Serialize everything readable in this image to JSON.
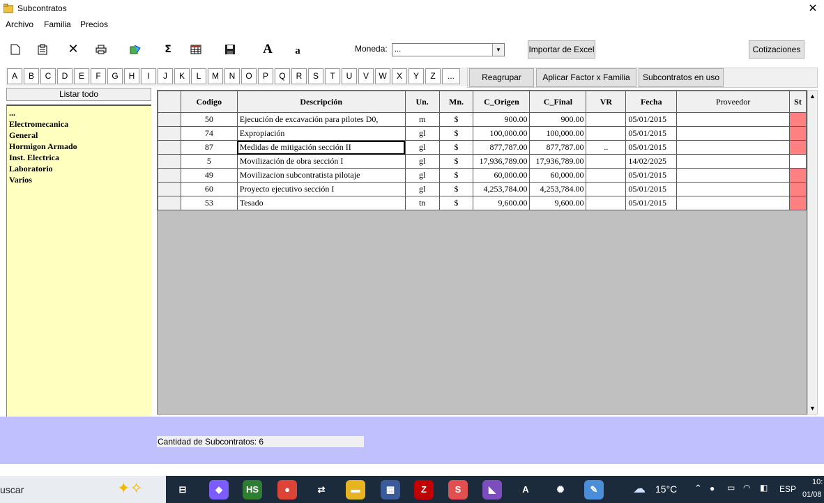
{
  "window": {
    "title": "Subcontratos",
    "close": "✕"
  },
  "menu": [
    {
      "label": "Archivo"
    },
    {
      "label": "Familia"
    },
    {
      "label": "Precios"
    }
  ],
  "toolbar": {
    "icons": [
      "new-document-icon",
      "properties-icon",
      "delete-icon",
      "print-icon",
      "import-icon",
      "sum-icon",
      "table-icon",
      "save-icon",
      "font-large-icon",
      "font-small-icon"
    ],
    "sum_glyph": "Σ",
    "font_large": "A",
    "font_small": "a",
    "moneda_label": "Moneda:",
    "moneda_value": "...",
    "importar_label": "Importar de Excel",
    "cotizaciones_label": "Cotizaciones"
  },
  "letters": [
    "A",
    "B",
    "C",
    "D",
    "E",
    "F",
    "G",
    "H",
    "I",
    "J",
    "K",
    "L",
    "M",
    "N",
    "O",
    "P",
    "Q",
    "R",
    "S",
    "T",
    "U",
    "V",
    "W",
    "X",
    "Y",
    "Z",
    "..."
  ],
  "actions": {
    "reagrupar": "Reagrupar",
    "aplicar": "Aplicar Factor x Familia",
    "en_uso": "Subcontratos en uso"
  },
  "sidebar": {
    "listar_label": "Listar todo",
    "families": [
      "...",
      "Electromecanica",
      "General",
      "Hormigon Armado",
      "Inst. Electrica",
      "Laboratorio",
      "Varios"
    ]
  },
  "grid": {
    "columns": [
      "Codigo",
      "Descripción",
      "Un.",
      "Mn.",
      "C_Origen",
      "C_Final",
      "VR",
      "Fecha",
      "Proveedor",
      "St"
    ],
    "rows": [
      {
        "codigo": "50",
        "desc": "Ejecución de excavación para pilotes D0,",
        "un": "m",
        "mn": "$",
        "origen": "900.00",
        "final": "900.00",
        "vr": "",
        "fecha": "05/01/2015",
        "prov": "",
        "st": "red"
      },
      {
        "codigo": "74",
        "desc": "Expropiación",
        "un": "gl",
        "mn": "$",
        "origen": "100,000.00",
        "final": "100,000.00",
        "vr": "",
        "fecha": "05/01/2015",
        "prov": "",
        "st": "red"
      },
      {
        "codigo": "87",
        "desc": "Medidas de mitigación sección II",
        "un": "gl",
        "mn": "$",
        "origen": "877,787.00",
        "final": "877,787.00",
        "vr": "..",
        "fecha": "05/01/2015",
        "prov": "",
        "st": "red"
      },
      {
        "codigo": "5",
        "desc": "Movilización de obra sección I",
        "un": "gl",
        "mn": "$",
        "origen": "17,936,789.00",
        "final": "17,936,789.00",
        "vr": "",
        "fecha": "14/02/2025",
        "prov": "",
        "st": "white"
      },
      {
        "codigo": "49",
        "desc": "Movilizacion subcontratista pilotaje",
        "un": "gl",
        "mn": "$",
        "origen": "60,000.00",
        "final": "60,000.00",
        "vr": "",
        "fecha": "05/01/2015",
        "prov": "",
        "st": "red"
      },
      {
        "codigo": "60",
        "desc": "Proyecto ejecutivo sección I",
        "un": "gl",
        "mn": "$",
        "origen": "4,253,784.00",
        "final": "4,253,784.00",
        "vr": "",
        "fecha": "05/01/2015",
        "prov": "",
        "st": "red"
      },
      {
        "codigo": "53",
        "desc": "Tesado",
        "un": "tn",
        "mn": "$",
        "origen": "9,600.00",
        "final": "9,600.00",
        "vr": "",
        "fecha": "05/01/2015",
        "prov": "",
        "st": "red"
      }
    ]
  },
  "status": {
    "count_text": "Cantidad de Subcontratos: 6"
  },
  "taskbar": {
    "search": "uscar",
    "apps": [
      {
        "name": "task-view-icon",
        "glyph": "⊟",
        "color": "#1c2b3c"
      },
      {
        "name": "copilot-icon",
        "glyph": "◆",
        "color": "#7b5cff"
      },
      {
        "name": "hs-app-icon",
        "glyph": "HS",
        "color": "#2e7d32"
      },
      {
        "name": "chrome-icon",
        "glyph": "●",
        "color": "#db4437"
      },
      {
        "name": "network-app-icon",
        "glyph": "⇄",
        "color": "#1c2b3c"
      },
      {
        "name": "file-explorer-icon",
        "glyph": "▬",
        "color": "#e6b422"
      },
      {
        "name": "pixel-app-icon",
        "glyph": "▦",
        "color": "#3a5a9a"
      },
      {
        "name": "filezilla-icon",
        "glyph": "Z",
        "color": "#bf0000"
      },
      {
        "name": "red-app-icon",
        "glyph": "S",
        "color": "#e05050"
      },
      {
        "name": "visual-studio-icon",
        "glyph": "◣",
        "color": "#7c4dbd"
      },
      {
        "name": "ai-app-icon",
        "glyph": "A",
        "color": "#1c2b3c"
      },
      {
        "name": "chatgpt-icon",
        "glyph": "✺",
        "color": "#1c2b3c"
      },
      {
        "name": "paint-icon",
        "glyph": "✎",
        "color": "#4a8ed8"
      }
    ],
    "weather": "15°C",
    "lang": "ESP",
    "time": "10:",
    "date": "01/08"
  },
  "colors": {
    "status_red": "#ff8080",
    "sidebar_bg": "#ffffc0",
    "bottom_bg": "#c0c0ff",
    "grid_bg": "#c0c0c0"
  }
}
